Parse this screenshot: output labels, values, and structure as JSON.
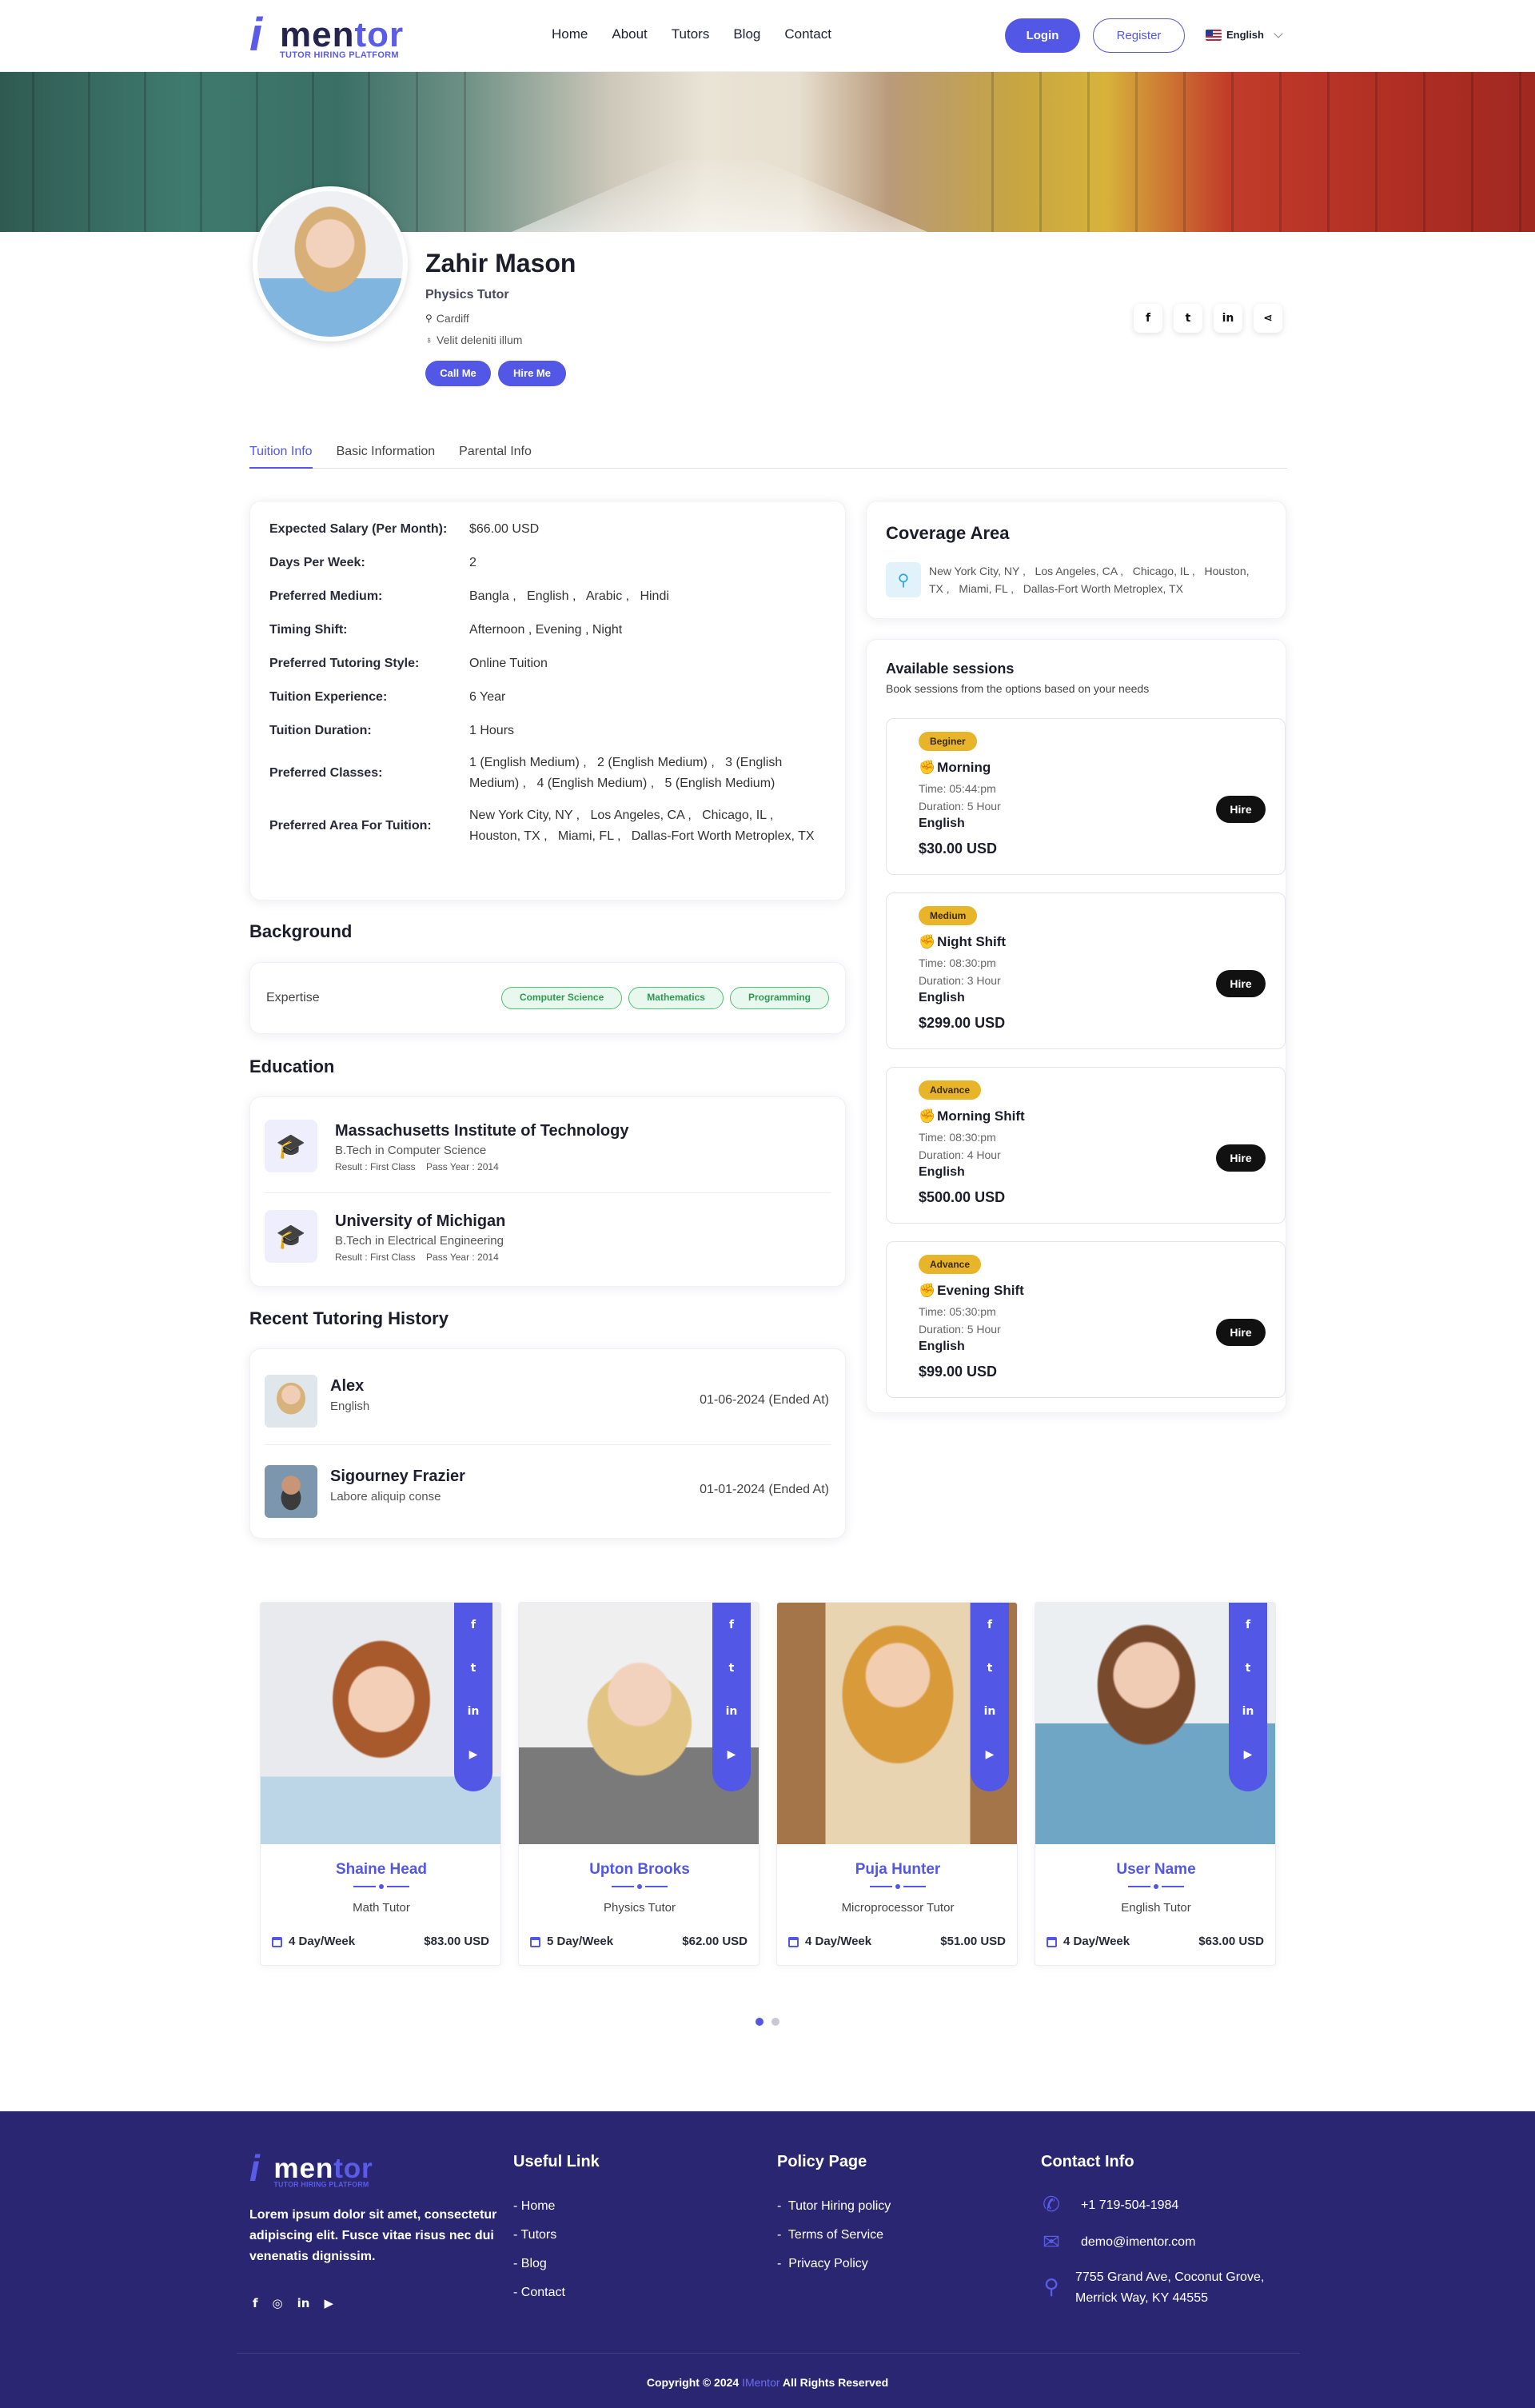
{
  "brand": {
    "logo_i": "i",
    "logo_word_a": "men",
    "logo_word_b": "tor",
    "tagline": "TUTOR HIRING PLATFORM"
  },
  "nav": [
    "Home",
    "About",
    "Tutors",
    "Blog",
    "Contact"
  ],
  "header": {
    "login": "Login",
    "register": "Register",
    "language": "English"
  },
  "profile": {
    "name": "Zahir Mason",
    "title": "Physics Tutor",
    "location": "Cardiff",
    "note": "Velit deleniti illum",
    "call_btn": "Call Me",
    "hire_btn": "Hire Me",
    "social_icons": [
      "facebook-icon",
      "twitter-icon",
      "linkedin-icon",
      "share-icon"
    ]
  },
  "tabs": [
    "Tuition Info",
    "Basic Information",
    "Parental Info"
  ],
  "tuition": [
    {
      "label": "Expected Salary (Per Month):",
      "value": "$66.00 USD"
    },
    {
      "label": "Days Per Week:",
      "value": "2"
    },
    {
      "label": "Preferred Medium:",
      "value": "Bangla ,   English ,   Arabic ,   Hindi"
    },
    {
      "label": "Timing Shift:",
      "value": "Afternoon , Evening , Night"
    },
    {
      "label": "Preferred Tutoring Style:",
      "value": "Online Tuition"
    },
    {
      "label": "Tuition Experience:",
      "value": "6 Year"
    },
    {
      "label": "Tuition Duration:",
      "value": "1 Hours"
    },
    {
      "label": "Preferred Classes:",
      "value": "1 (English Medium) ,   2 (English Medium) ,   3 (English Medium) ,   4 (English Medium) ,   5 (English Medium)"
    },
    {
      "label": "Preferred Area For Tuition:",
      "value": "New York City, NY ,   Los Angeles, CA ,   Chicago, IL ,   Houston, TX ,   Miami, FL ,   Dallas-Fort Worth Metroplex, TX"
    }
  ],
  "background": {
    "title": "Background",
    "label": "Expertise",
    "tags": [
      "Computer Science",
      "Mathematics",
      "Programming"
    ]
  },
  "education": {
    "title": "Education",
    "items": [
      {
        "school": "Massachusetts Institute of Technology",
        "degree": "B.Tech in Computer Science",
        "result": "Result : First Class    Pass Year : 2014"
      },
      {
        "school": "University of Michigan",
        "degree": "B.Tech in Electrical Engineering",
        "result": "Result : First Class    Pass Year : 2014"
      }
    ]
  },
  "history": {
    "title": "Recent Tutoring History",
    "items": [
      {
        "name": "Alex",
        "subject": "English",
        "date": "01-06-2024 (Ended At)"
      },
      {
        "name": "Sigourney Frazier",
        "subject": "Labore aliquip conse",
        "date": "01-01-2024 (Ended At)"
      }
    ]
  },
  "coverage": {
    "title": "Coverage Area",
    "areas": "New York City, NY ,   Los Angeles, CA ,   Chicago, IL ,   Houston, TX ,   Miami, FL ,   Dallas-Fort Worth Metroplex, TX"
  },
  "sessions": {
    "title": "Available sessions",
    "subtitle": "Book sessions from the options based on your needs",
    "hire_label": "Hire",
    "items": [
      {
        "level": "Beginer",
        "name": "Morning",
        "time": "Time: 05:44:pm",
        "duration": "Duration: 5 Hour",
        "language": "English",
        "price": "$30.00 USD"
      },
      {
        "level": "Medium",
        "name": "Night Shift",
        "time": "Time: 08:30:pm",
        "duration": "Duration: 3 Hour",
        "language": "English",
        "price": "$299.00 USD"
      },
      {
        "level": "Advance",
        "name": "Morning Shift",
        "time": "Time: 08:30:pm",
        "duration": "Duration: 4 Hour",
        "language": "English",
        "price": "$500.00 USD"
      },
      {
        "level": "Advance",
        "name": "Evening Shift",
        "time": "Time: 05:30:pm",
        "duration": "Duration: 5 Hour",
        "language": "English",
        "price": "$99.00 USD"
      }
    ]
  },
  "tutors": [
    {
      "name": "Shaine Head",
      "subject": "Math Tutor",
      "days": "4 Day/Week",
      "price": "$83.00 USD"
    },
    {
      "name": "Upton Brooks",
      "subject": "Physics Tutor",
      "days": "5 Day/Week",
      "price": "$62.00 USD"
    },
    {
      "name": "Puja Hunter",
      "subject": "Microprocessor Tutor",
      "days": "4 Day/Week",
      "price": "$51.00 USD"
    },
    {
      "name": "User Name",
      "subject": "English Tutor",
      "days": "4 Day/Week",
      "price": "$63.00 USD"
    }
  ],
  "carousel": {
    "pages": 2,
    "active": 1
  },
  "footer": {
    "about": "Lorem ipsum dolor sit amet, consectetur adipiscing elit. Fusce vitae risus nec dui venenatis dignissim.",
    "useful_title": "Useful Link",
    "useful_links": [
      "- Home",
      "- Tutors",
      "- Blog",
      "- Contact"
    ],
    "policy_title": "Policy Page",
    "policy_links": [
      "-  Tutor Hiring policy",
      "-  Terms of Service",
      "-  Privacy Policy"
    ],
    "contact_title": "Contact Info",
    "phone": "+1 719-504-1984",
    "email": "demo@imentor.com",
    "address": "7755 Grand Ave, Coconut Grove, Merrick Way, KY 44555",
    "copy_a": "Copyright © 2024 ",
    "copy_brand": "IMentor",
    "copy_b": " All Rights Reserved"
  },
  "colors": {
    "primary": "#5257e5",
    "footer_bg": "#2b2672",
    "tag_green": "#4cc06f",
    "level_badge": "#e7b42a"
  }
}
